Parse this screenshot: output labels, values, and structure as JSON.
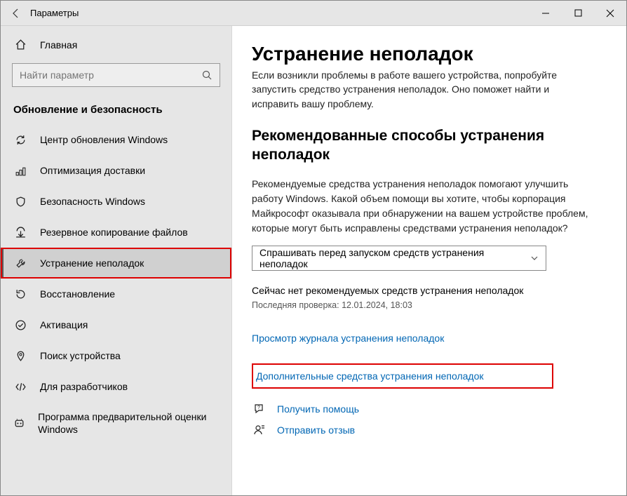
{
  "titlebar": {
    "title": "Параметры"
  },
  "sidebar": {
    "home": "Главная",
    "search_placeholder": "Найти параметр",
    "group": "Обновление и безопасность",
    "items": [
      {
        "label": "Центр обновления Windows"
      },
      {
        "label": "Оптимизация доставки"
      },
      {
        "label": "Безопасность Windows"
      },
      {
        "label": "Резервное копирование файлов"
      },
      {
        "label": "Устранение неполадок"
      },
      {
        "label": "Восстановление"
      },
      {
        "label": "Активация"
      },
      {
        "label": "Поиск устройства"
      },
      {
        "label": "Для разработчиков"
      },
      {
        "label": "Программа предварительной оценки Windows"
      }
    ]
  },
  "main": {
    "title": "Устранение неполадок",
    "intro": "Если возникли проблемы в работе вашего устройства, попробуйте запустить средство устранения неполадок. Оно поможет найти и исправить вашу проблему.",
    "recommended_heading": "Рекомендованные способы устранения неполадок",
    "recommended_para": "Рекомендуемые средства устранения неполадок помогают улучшить работу Windows. Какой объем помощи вы хотите, чтобы корпорация Майкрософт оказывала при обнаружении на вашем устройстве проблем, которые могут быть исправлены средствами устранения неполадок?",
    "dropdown_value": "Спрашивать перед запуском средств устранения неполадок",
    "status": "Сейчас нет рекомендуемых средств устранения неполадок",
    "last_check": "Последняя проверка: 12.01.2024, 18:03",
    "history_link": "Просмотр журнала устранения неполадок",
    "more_link": "Дополнительные средства устранения неполадок",
    "help_link": "Получить помощь",
    "feedback_link": "Отправить отзыв"
  }
}
